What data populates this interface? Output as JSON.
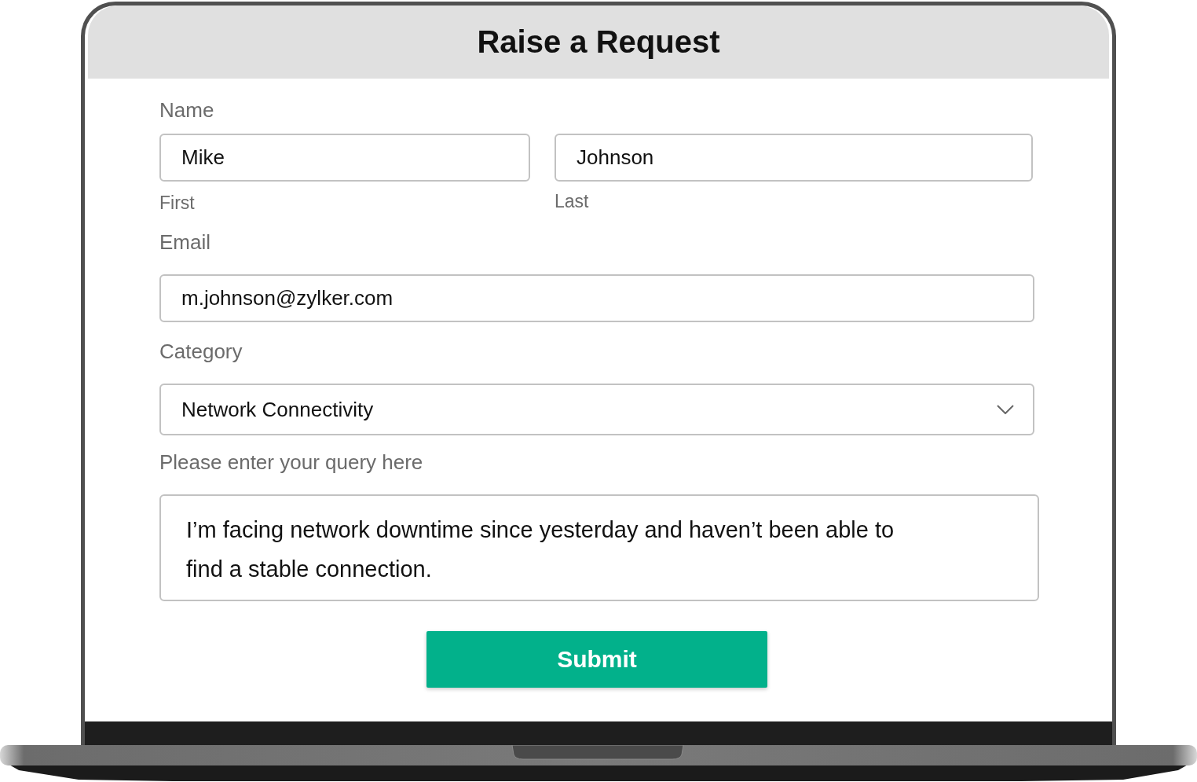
{
  "title": "Raise a Request",
  "form": {
    "name": {
      "label": "Name",
      "first": {
        "value": "Mike",
        "sublabel": "First"
      },
      "last": {
        "value": "Johnson",
        "sublabel": "Last"
      }
    },
    "email": {
      "label": "Email",
      "value": "m.johnson@zylker.com"
    },
    "category": {
      "label": "Category",
      "value": "Network Connectivity"
    },
    "query": {
      "label": "Please enter your query here",
      "value": "I’m facing network downtime since yesterday and haven’t been able to find a stable connection."
    },
    "submit": "Submit"
  }
}
